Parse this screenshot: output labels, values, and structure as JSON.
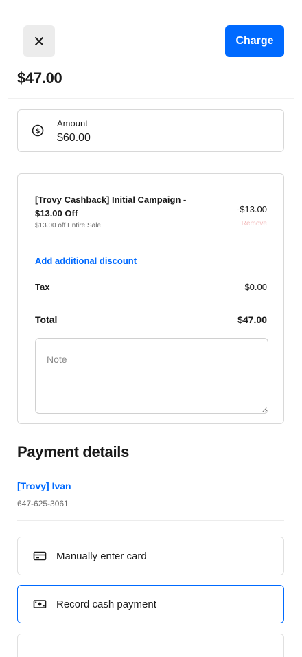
{
  "header": {
    "charge_label": "Charge",
    "total": "$47.00"
  },
  "amount": {
    "label": "Amount",
    "value": "$60.00"
  },
  "discount": {
    "title": "[Trovy Cashback] Initial Campaign - $13.00 Off",
    "subtitle": "$13.00 off Entire Sale",
    "amount": "-$13.00",
    "remove_label": "Remove"
  },
  "add_discount_label": "Add additional discount",
  "tax": {
    "label": "Tax",
    "value": "$0.00"
  },
  "total": {
    "label": "Total",
    "value": "$47.00"
  },
  "note": {
    "placeholder": "Note"
  },
  "payment": {
    "heading": "Payment details",
    "customer_name": "[Trovy] Ivan",
    "customer_phone": "647-625-3061",
    "options": {
      "manual_card": "Manually enter card",
      "cash": "Record cash payment"
    }
  },
  "colors": {
    "accent": "#006aff",
    "remove": "#f2b8b8"
  },
  "icons": {
    "close": "close-icon",
    "amount": "dollar-circle-icon",
    "card": "credit-card-icon",
    "cash": "cash-icon"
  }
}
